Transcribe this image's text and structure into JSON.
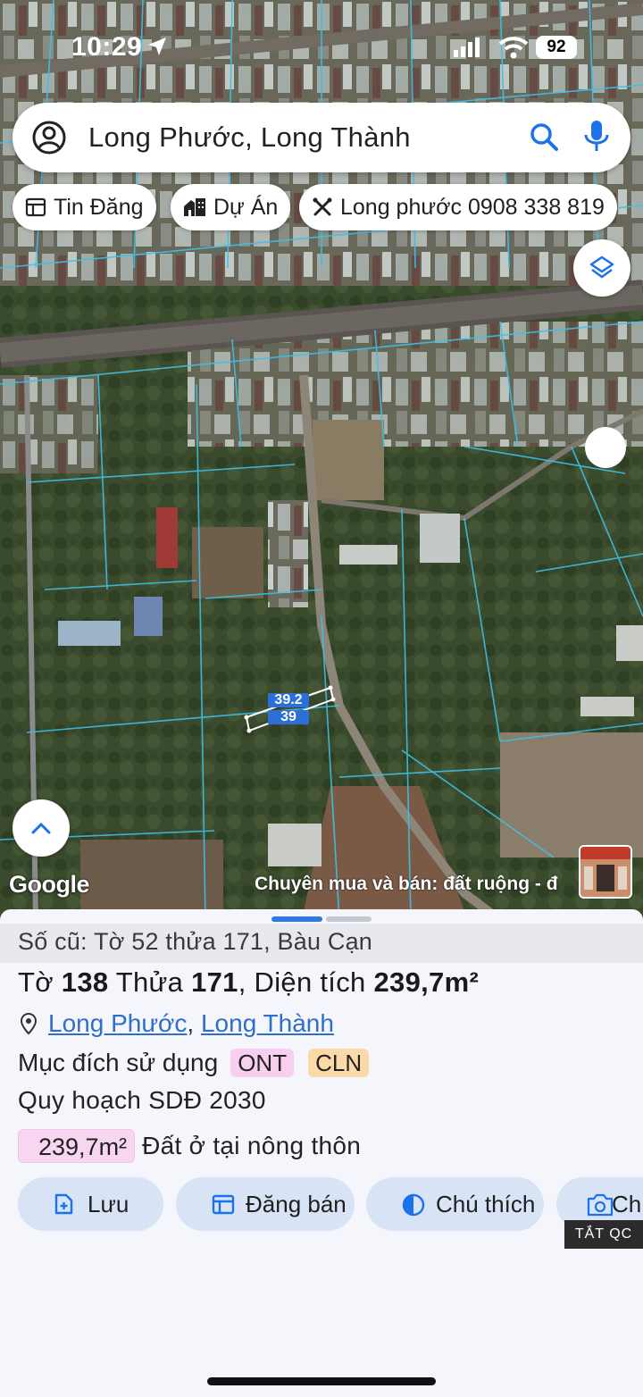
{
  "status_bar": {
    "time": "10:29",
    "battery": "92"
  },
  "search": {
    "query": "Long Phước, Long Thành"
  },
  "chips": [
    {
      "label": "Tin Đăng",
      "icon": "listing-icon"
    },
    {
      "label": "Dự Án",
      "icon": "project-icon"
    },
    {
      "label": "Long phước 0908 338 819",
      "icon": "tools-icon"
    }
  ],
  "map": {
    "plot_labels": [
      "39.2",
      "39"
    ],
    "google_logo": "Google",
    "ad_text": "Chuyên mua và bán: đất ruộng - đ"
  },
  "sheet": {
    "old_info": "Số cũ: Tờ 52 thửa 171, Bàu Cạn",
    "title": {
      "to_label": "Tờ",
      "to_value": "138",
      "thua_label": "Thửa",
      "thua_value": "171",
      "dt_label": ", Diện tích",
      "dt_value": "239,7m²"
    },
    "location": {
      "ward": "Long Phước",
      "separator": ",",
      "district": "Long Thành"
    },
    "purpose_label": "Mục đích sử dụng",
    "purpose_badges": [
      "ONT",
      "CLN"
    ],
    "plan_label": "Quy hoạch SDĐ 2030",
    "area_value": "239,7m²",
    "area_desc": "Đất ở tại nông thôn",
    "actions": [
      "Lưu",
      "Đăng bán",
      "Chú thích",
      "Ch"
    ],
    "ad_close": "TẮT QC"
  },
  "colors": {
    "accent": "#2f6fc9",
    "action_bg": "#d8e3f6",
    "ont": "#f8cfee",
    "cln": "#fcd9a8"
  }
}
